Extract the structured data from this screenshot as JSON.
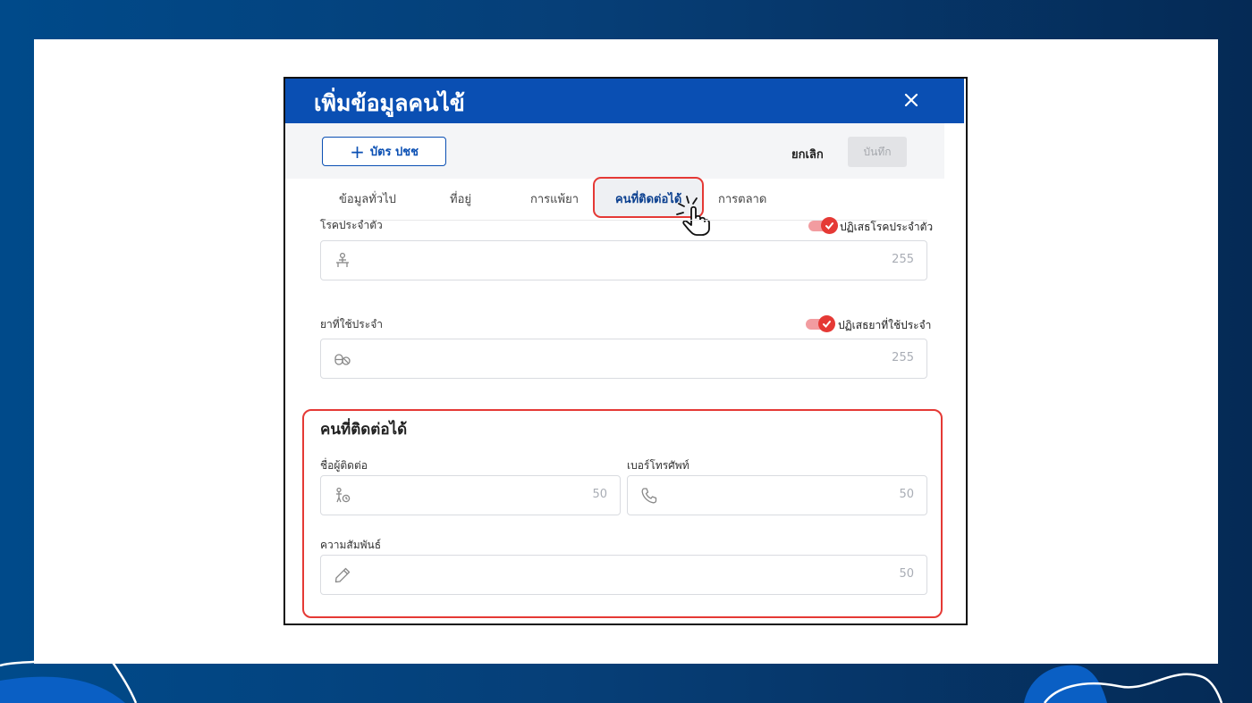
{
  "dialog": {
    "title": "เพิ่มข้อมูลคนไข้",
    "close_icon": "close-icon"
  },
  "toolbar": {
    "id_card_label": "บัตร ปชช",
    "cancel_label": "ยกเลิก",
    "save_label": "บันทึก"
  },
  "tabs": [
    {
      "label": "ข้อมูลทั่วไป",
      "active": false
    },
    {
      "label": "ที่อยู่",
      "active": false
    },
    {
      "label": "การแพ้ยา",
      "active": false
    },
    {
      "label": "คนที่ติดต่อได้",
      "active": true
    },
    {
      "label": "การตลาด",
      "active": false
    }
  ],
  "fields": {
    "chronic_disease": {
      "label": "โรคประจำตัว",
      "toggle_label": "ปฏิเสธโรคประจำตัว",
      "toggle_on": true,
      "counter": "255",
      "icon": "person-bed-icon"
    },
    "regular_medication": {
      "label": "ยาที่ใช้ประจำ",
      "toggle_label": "ปฏิเสธยาที่ใช้ประจำ",
      "toggle_on": true,
      "counter": "255",
      "icon": "pills-icon"
    }
  },
  "contact_section": {
    "title": "คนที่ติดต่อได้",
    "contact_name": {
      "label": "ชื่อผู้ติดต่อ",
      "counter": "50",
      "icon": "person-clock-icon"
    },
    "phone": {
      "label": "เบอร์โทรศัพท์",
      "counter": "50",
      "icon": "phone-icon"
    },
    "relationship": {
      "label": "ความสัมพันธ์",
      "counter": "50",
      "icon": "pencil-icon"
    }
  },
  "colors": {
    "primary": "#0a4fb3",
    "highlight": "#e53935",
    "background_navy": "#063f78"
  }
}
